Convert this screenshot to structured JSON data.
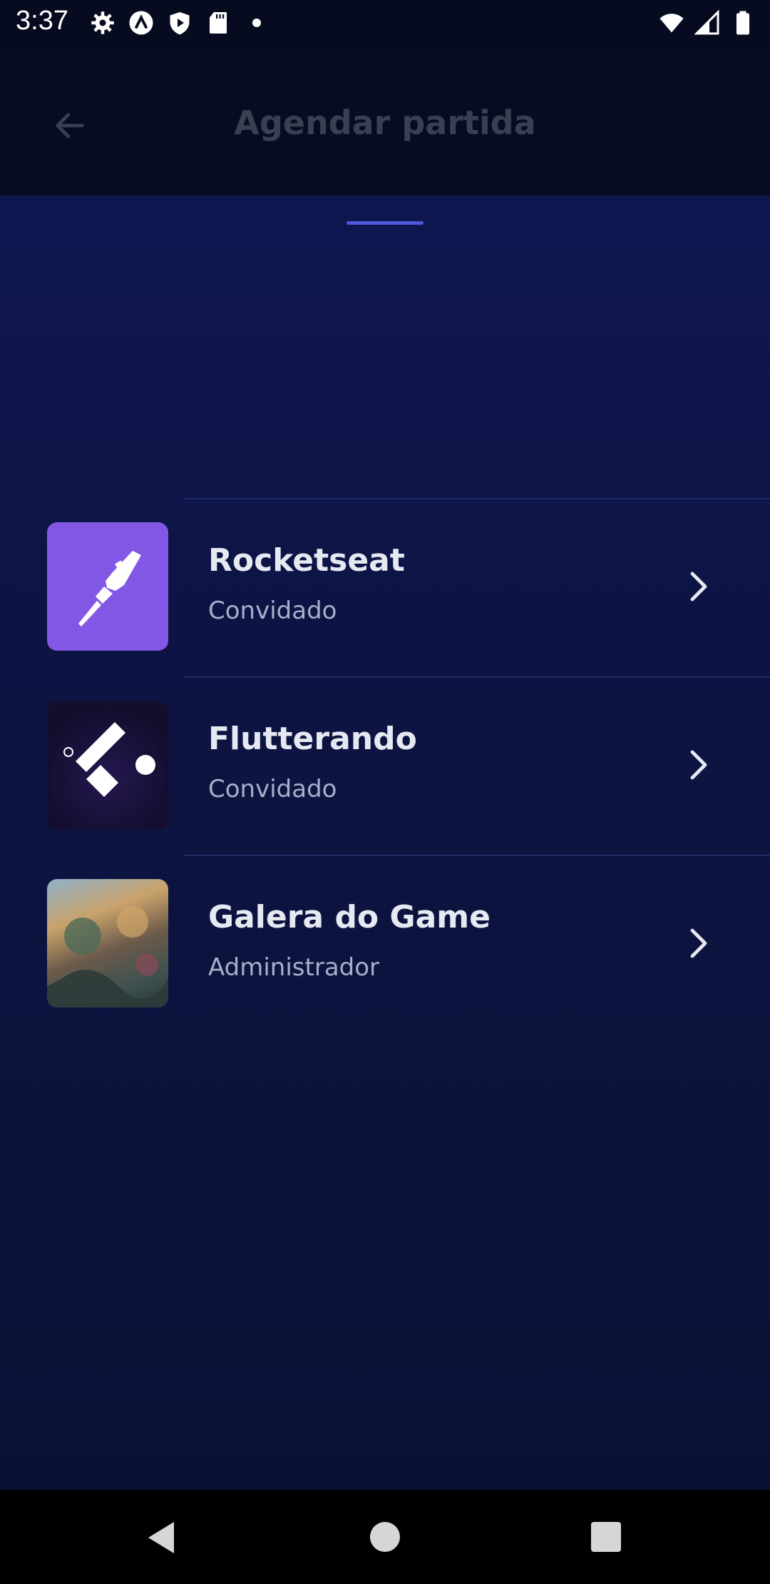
{
  "status_bar": {
    "time": "3:37",
    "left_icons": [
      "settings-icon",
      "a-circle-icon",
      "shield-play-icon",
      "sd-card-icon",
      "dot-icon"
    ],
    "right_icons": [
      "wifi-icon",
      "signal-icon",
      "battery-icon"
    ]
  },
  "header": {
    "title": "Agendar partida",
    "back_icon": "arrow-left-icon"
  },
  "groups": [
    {
      "name": "Rocketseat",
      "role": "Convidado",
      "avatar": "rocketseat-logo",
      "avatar_color": "#8257e5"
    },
    {
      "name": "Flutterando",
      "role": "Convidado",
      "avatar": "flutterando-logo",
      "avatar_color": "#140d2e"
    },
    {
      "name": "Galera do Game",
      "role": "Administrador",
      "avatar": "game-art-image",
      "avatar_color": "#5b6f7a"
    }
  ],
  "colors": {
    "background": "#0b1033",
    "sheet_handle": "#4b59d8",
    "title_dimmed": "#3b3f52",
    "group_name": "#e6e8f2",
    "group_role": "#a9aec9"
  }
}
